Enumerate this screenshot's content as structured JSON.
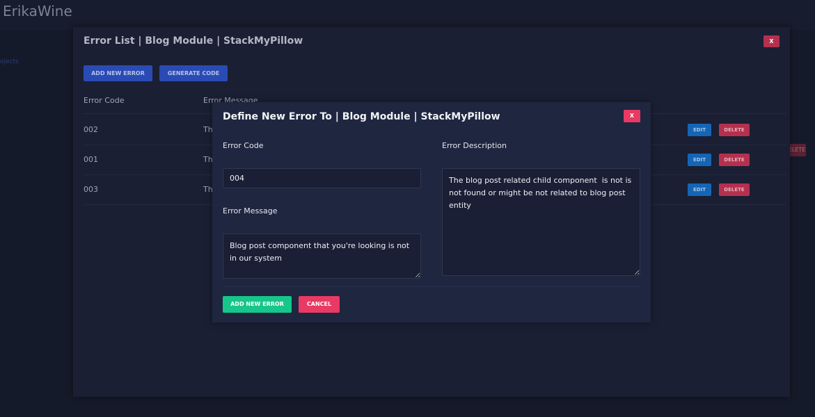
{
  "app": {
    "title": "ErikaWine",
    "sidebar_link": "ojects"
  },
  "background": {
    "delete_label": "DELETE"
  },
  "outer_modal": {
    "title": "Error List | Blog Module | StackMyPillow",
    "close_label": "X",
    "add_button": "ADD NEW ERROR",
    "generate_button": "GENERATE CODE",
    "columns": [
      "Error Code",
      "Error Message"
    ],
    "rows": [
      {
        "code": "002",
        "message": "Th",
        "edit": "EDIT",
        "delete": "DELETE"
      },
      {
        "code": "001",
        "message": "Th",
        "edit": "EDIT",
        "delete": "DELETE"
      },
      {
        "code": "003",
        "message": "Th",
        "edit": "EDIT",
        "delete": "DELETE"
      }
    ]
  },
  "inner_modal": {
    "title": "Define New Error To | Blog Module | StackMyPillow",
    "close_label": "X",
    "error_code_label": "Error Code",
    "error_code_value": "004",
    "error_message_label": "Error Message",
    "error_message_value": "Blog post component that you're looking is not in our system",
    "error_description_label": "Error Description",
    "error_description_value": "The blog post related child component  is not is not found or might be not related to blog post entity",
    "add_button": "ADD NEW ERROR",
    "cancel_button": "CANCEL"
  },
  "colors": {
    "background": "#151a2a",
    "modal": "#1a1f33",
    "inner_modal": "#1f2640",
    "primary_blue": "#2a4bb5",
    "danger": "#e83a64",
    "success": "#17c68a"
  }
}
